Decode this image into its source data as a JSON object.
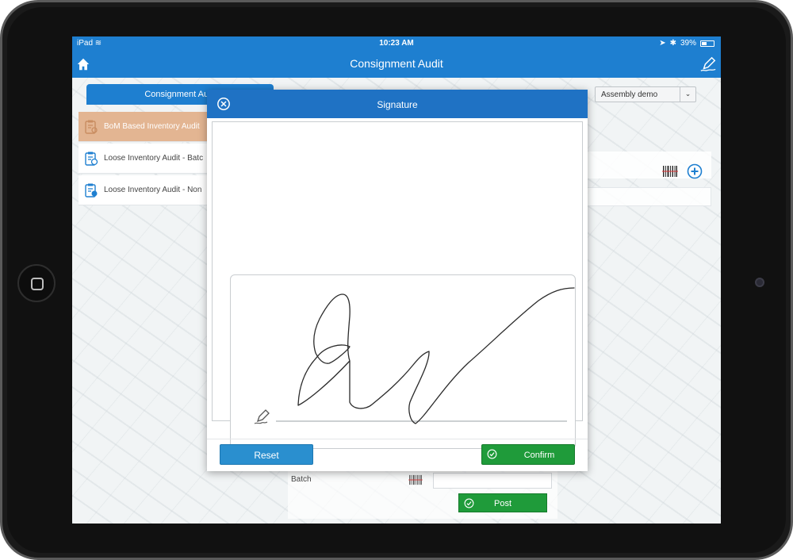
{
  "status_bar": {
    "device": "iPad",
    "time": "10:23 AM",
    "battery": "39%"
  },
  "nav": {
    "title": "Consignment Audit"
  },
  "left_panel": {
    "tab_label": "Consignment Audi",
    "items": [
      {
        "label": "BoM Based Inventory Audit",
        "active": true
      },
      {
        "label": "Loose Inventory Audit - Batc",
        "active": false
      },
      {
        "label": "Loose Inventory Audit - Non",
        "active": false
      }
    ]
  },
  "assembly_select": {
    "value": "Assembly demo"
  },
  "bottom": {
    "batch_label": "Batch",
    "post_label": "Post"
  },
  "modal": {
    "title": "Signature",
    "reset_label": "Reset",
    "confirm_label": "Confirm"
  },
  "colors": {
    "primary": "#1e7fd0",
    "confirm_green": "#1f9b3a",
    "active_item": "#e3b592"
  },
  "icons": [
    "home-icon",
    "edit-icon",
    "close-icon",
    "pen-icon",
    "barcode-icon",
    "plus-icon",
    "check-icon"
  ]
}
